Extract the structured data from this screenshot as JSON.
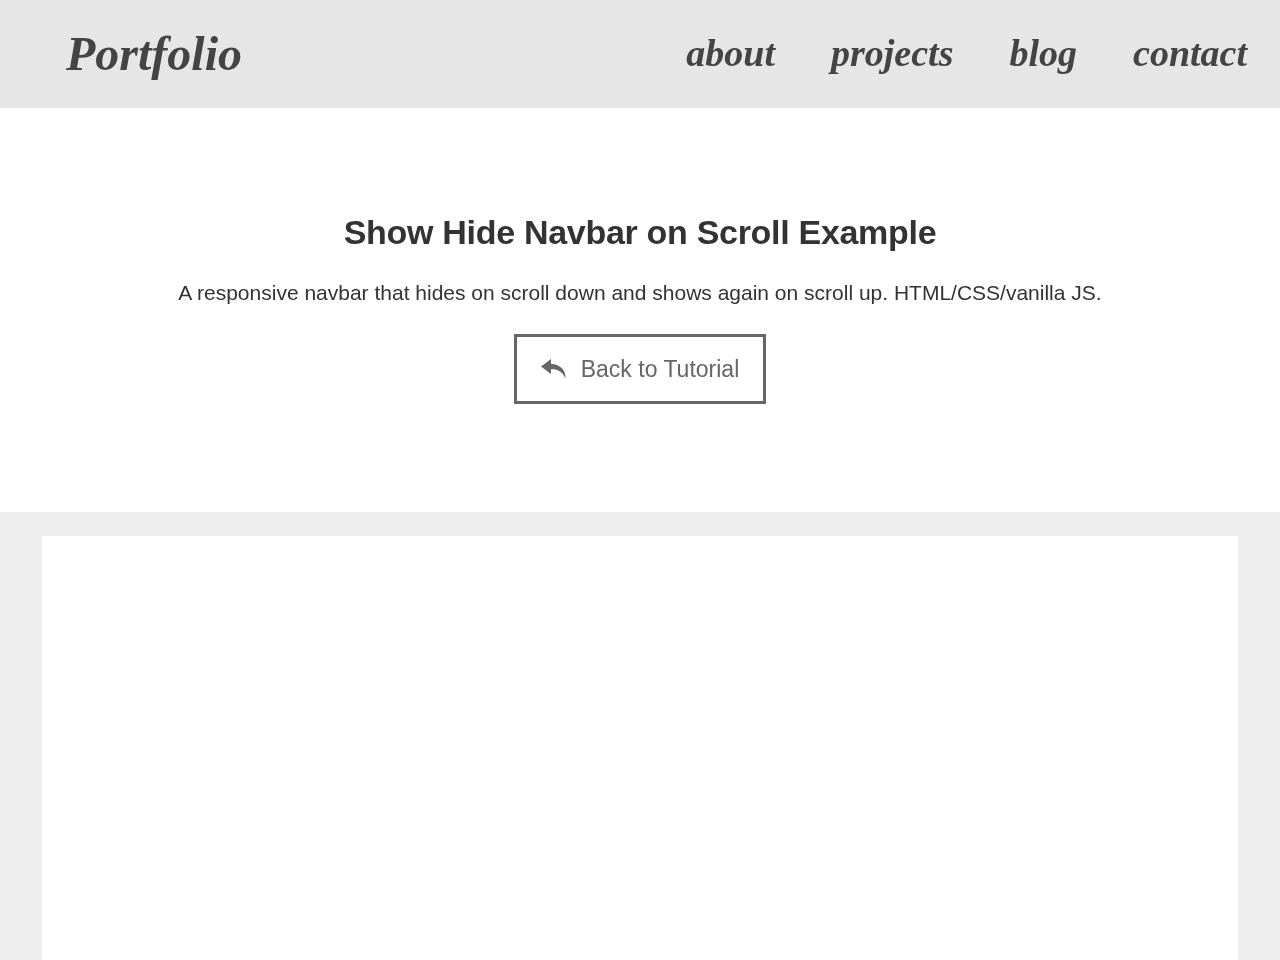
{
  "navbar": {
    "brand": "Portfolio",
    "links": [
      {
        "label": "about"
      },
      {
        "label": "projects"
      },
      {
        "label": "blog"
      },
      {
        "label": "contact"
      }
    ]
  },
  "header": {
    "title": "Show Hide Navbar on Scroll Example",
    "description": "A responsive navbar that hides on scroll down and shows again on scroll up. HTML/CSS/vanilla JS.",
    "button": {
      "label": "Back to Tutorial"
    }
  }
}
